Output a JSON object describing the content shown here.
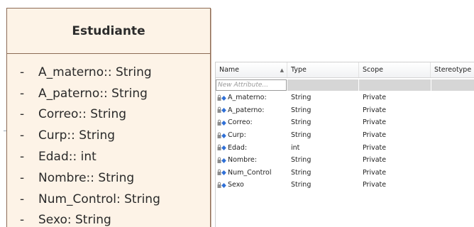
{
  "uml_class": {
    "name": "Estudiante",
    "attributes": [
      {
        "visibility": "-",
        "text": "A_materno:: String"
      },
      {
        "visibility": "-",
        "text": "A_paterno:: String"
      },
      {
        "visibility": "-",
        "text": "Correo:: String"
      },
      {
        "visibility": "-",
        "text": "Curp:: String"
      },
      {
        "visibility": "-",
        "text": "Edad:: int"
      },
      {
        "visibility": "-",
        "text": "Nombre:: String"
      },
      {
        "visibility": "-",
        "text": "Num_Control: String"
      },
      {
        "visibility": "-",
        "text": "Sexo: String"
      }
    ]
  },
  "attributes_grid": {
    "columns": [
      "Name",
      "Type",
      "Scope",
      "Stereotype"
    ],
    "sort_indicator": "▲",
    "new_placeholder": "New Attribute...",
    "rows": [
      {
        "name": "A_materno:",
        "type": "String",
        "scope": "Private"
      },
      {
        "name": "A_paterno:",
        "type": "String",
        "scope": "Private"
      },
      {
        "name": "Correo:",
        "type": "String",
        "scope": "Private"
      },
      {
        "name": "Curp:",
        "type": "String",
        "scope": "Private"
      },
      {
        "name": "Edad:",
        "type": "int",
        "scope": "Private"
      },
      {
        "name": "Nombre:",
        "type": "String",
        "scope": "Private"
      },
      {
        "name": "Num_Control",
        "type": "String",
        "scope": "Private"
      },
      {
        "name": "Sexo",
        "type": "String",
        "scope": "Private"
      }
    ]
  },
  "icons": {
    "attribute": "private-attribute-icon"
  },
  "colors": {
    "class_fill": "#fdf3e7",
    "class_border": "#8b6a54",
    "icon_blue": "#2f6fd6",
    "lock_gray": "#8c8c8c"
  }
}
